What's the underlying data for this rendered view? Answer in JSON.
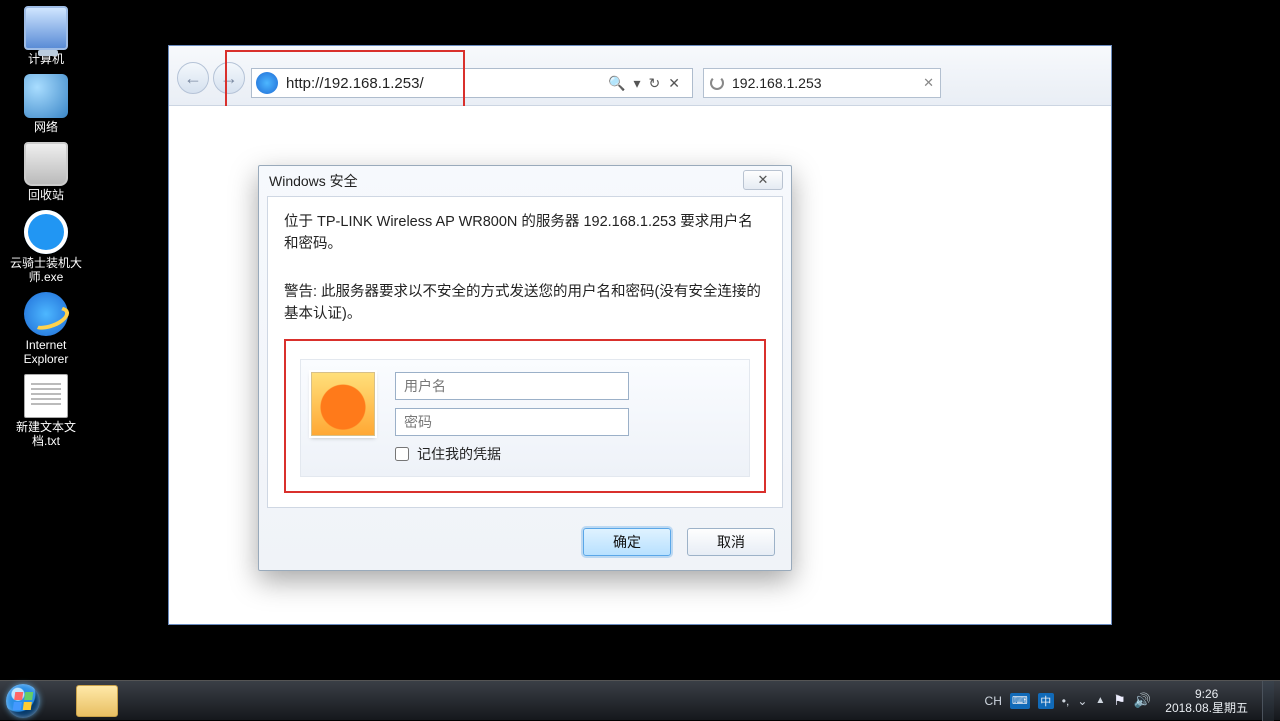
{
  "desktop": {
    "icons": [
      {
        "label": "计算机"
      },
      {
        "label": "网络"
      },
      {
        "label": "回收站"
      },
      {
        "label": "云骑士装机大师.exe"
      },
      {
        "label": "Internet Explorer"
      },
      {
        "label": "新建文本文档.txt"
      }
    ]
  },
  "browser": {
    "url": "http://192.168.1.253/",
    "search_icon": "🔍",
    "refresh_icon": "↻",
    "stop_icon": "✕",
    "tab": {
      "title": "192.168.1.253",
      "close": "✕"
    }
  },
  "dialog": {
    "title": "Windows 安全",
    "close": "✕",
    "message": "位于 TP-LINK Wireless AP WR800N 的服务器 192.168.1.253 要求用户名和密码。",
    "warning": "警告: 此服务器要求以不安全的方式发送您的用户名和密码(没有安全连接的基本认证)。",
    "username_placeholder": "用户名",
    "password_placeholder": "密码",
    "remember": "记住我的凭据",
    "ok": "确定",
    "cancel": "取消"
  },
  "taskbar": {
    "ime_lang": "CH",
    "ime_mode": "中",
    "clock_time": "9:26",
    "clock_date": "2018.08.星期五"
  }
}
